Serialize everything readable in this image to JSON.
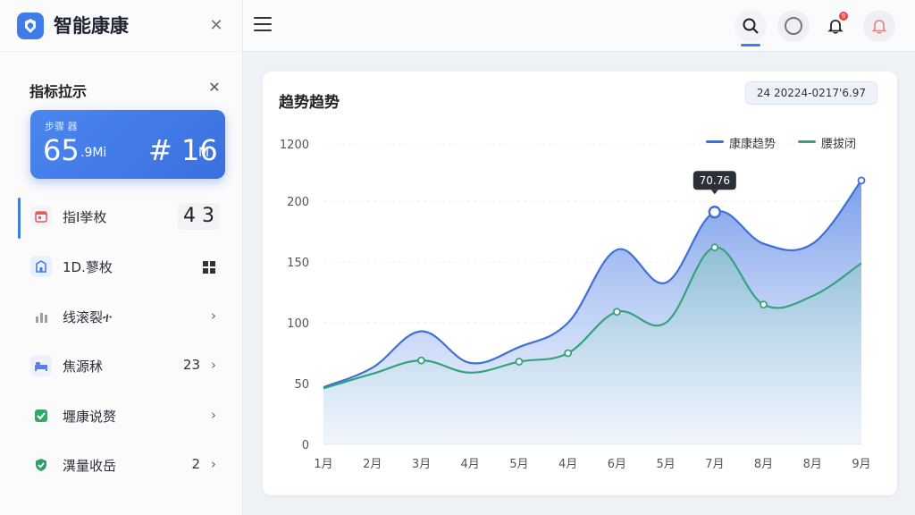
{
  "app": {
    "title": "智能康康"
  },
  "sidebar": {
    "panel_title": "指标拉示",
    "stat_card": {
      "label": "步骤 器",
      "value_a": "65",
      "unit_a": ".9Mi",
      "value_b": "# 16",
      "unit_b": "M"
    },
    "items": [
      {
        "label": "指I挙枚",
        "count": "4 3",
        "icon": "calendar-icon",
        "color": "#e35d5d"
      },
      {
        "label": "1D.蓼枚",
        "count": "",
        "icon": "building-icon",
        "color": "#3f7ce8"
      },
      {
        "label": "线滚裂ተ",
        "count": "",
        "icon": "bar-chart-icon",
        "color": "#9aa0aa"
      },
      {
        "label": "焦源秫",
        "count": "23",
        "icon": "bed-icon",
        "color": "#5b7fe0"
      },
      {
        "label": "壥康说赘",
        "count": "",
        "icon": "checkbox-icon",
        "color": "#34a86b"
      },
      {
        "label": "潩量收岳",
        "count": "2",
        "icon": "shield-icon",
        "color": "#2fa06a"
      }
    ]
  },
  "topbar": {
    "notification_count": "9"
  },
  "main": {
    "chart_title": "趋势趋势",
    "date_range": "24  20224-0217'6.97"
  },
  "chart_data": {
    "type": "area",
    "categories": [
      "1月",
      "2月",
      "3月",
      "4月",
      "5月",
      "4月",
      "6月",
      "5月",
      "7月",
      "8月",
      "8月",
      "9月"
    ],
    "ylim": [
      0,
      200
    ],
    "yticks": [
      "0",
      "50",
      "100",
      "150",
      "200",
      "1200"
    ],
    "series": [
      {
        "name": "康康趋势",
        "color": "#3f6fd8",
        "values": [
          47,
          63,
          93,
          67,
          80,
          100,
          160,
          133,
          191,
          165,
          165,
          217
        ]
      },
      {
        "name": "腰拔闭",
        "color": "#36a27c",
        "values": [
          46,
          58,
          69,
          59,
          68,
          75,
          109,
          100,
          162,
          115,
          122,
          149
        ]
      }
    ],
    "tooltip": {
      "category_index": 8,
      "series_index": 0,
      "label": "70.76"
    }
  }
}
